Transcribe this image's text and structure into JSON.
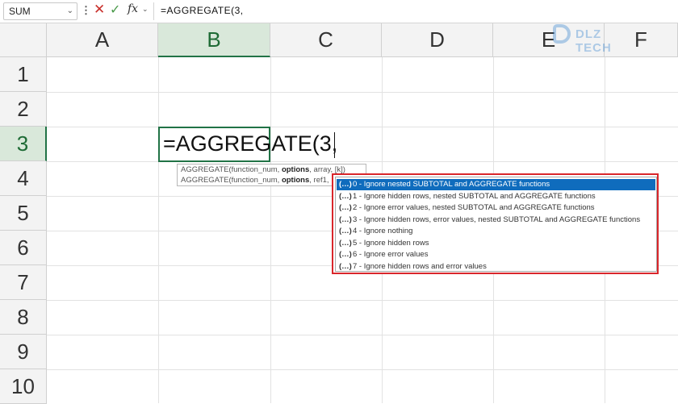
{
  "formula_bar": {
    "name_box": "SUM",
    "more_glyph": "⋮",
    "cancel_glyph": "✕",
    "enter_glyph": "✓",
    "fx_glyph": "fx",
    "formula": "=AGGREGATE(3,"
  },
  "columns": [
    "A",
    "B",
    "C",
    "D",
    "E",
    "F"
  ],
  "rows": [
    "1",
    "2",
    "3",
    "4",
    "5",
    "6",
    "7",
    "8",
    "9",
    "10"
  ],
  "active_cell": {
    "column": "B",
    "row": "3",
    "content": "=AGGREGATE(3,"
  },
  "tooltip": {
    "line1_pre": "AGGREGATE(function_num, ",
    "line1_bold": "options",
    "line1_post": ", array, [k])",
    "line2_pre": "AGGREGATE(function_num, ",
    "line2_bold": "options",
    "line2_post": ", ref1, ..."
  },
  "dropdown": {
    "icon": "(…)",
    "items": [
      "0 - Ignore nested SUBTOTAL and AGGREGATE functions",
      "1 - Ignore hidden rows, nested SUBTOTAL and AGGREGATE functions",
      "2 - Ignore error values, nested SUBTOTAL and AGGREGATE functions",
      "3 - Ignore hidden rows, error values, nested SUBTOTAL and AGGREGATE functions",
      "4 - Ignore nothing",
      "5 - Ignore hidden rows",
      "6 - Ignore error values",
      "7 - Ignore hidden rows and error values"
    ],
    "selected_index": 0
  },
  "watermark": {
    "text": "DLZ TECH"
  },
  "colors": {
    "accent": "#217346",
    "selection": "#0f6cbd",
    "highlight_border": "#d9262b"
  }
}
